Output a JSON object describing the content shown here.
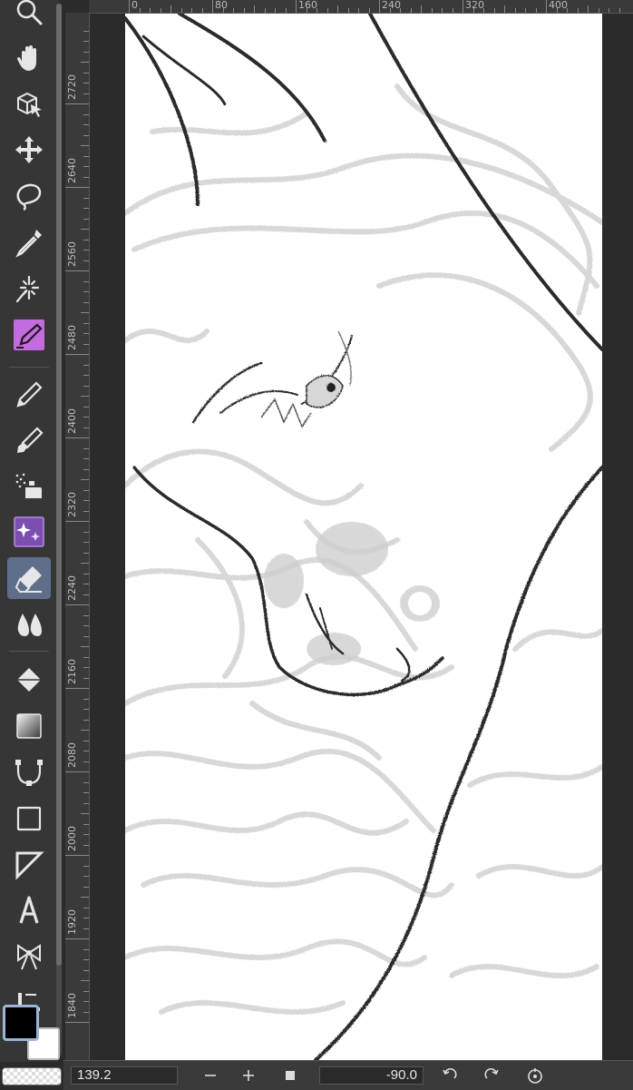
{
  "toolbar": {
    "tools": [
      {
        "name": "zoom-icon",
        "active": false
      },
      {
        "name": "hand-icon",
        "active": false
      },
      {
        "name": "operation-icon",
        "active": false
      },
      {
        "name": "move-layer-icon",
        "active": false
      },
      {
        "name": "lasso-select-icon",
        "active": false
      },
      {
        "name": "eyedropper-icon",
        "active": false
      },
      {
        "name": "auto-select-icon",
        "active": false
      },
      {
        "name": "pen-tool-icon",
        "active": false
      },
      {
        "name": "pencil-icon",
        "active": false
      },
      {
        "name": "brush-icon",
        "active": false
      },
      {
        "name": "airbrush-icon",
        "active": false
      },
      {
        "name": "decoration-icon",
        "active": false
      },
      {
        "name": "eraser-icon",
        "active": true
      },
      {
        "name": "blend-icon",
        "active": false
      },
      {
        "name": "fill-icon",
        "active": false
      },
      {
        "name": "gradient-icon",
        "active": false
      },
      {
        "name": "figure-curve-icon",
        "active": false
      },
      {
        "name": "rectangle-icon",
        "active": false
      },
      {
        "name": "frame-border-icon",
        "active": false
      },
      {
        "name": "text-icon",
        "active": false
      },
      {
        "name": "balloon-icon",
        "active": false
      },
      {
        "name": "ruler-tool-icon",
        "active": false
      }
    ]
  },
  "colors": {
    "main": "#000000",
    "sub": "#ffffff",
    "accent": "#c56be0",
    "active_tool_bg": "#5f6f8a"
  },
  "rulers": {
    "horizontal": [
      "0",
      "80",
      "160",
      "240",
      "320",
      "400"
    ],
    "vertical": [
      "2720",
      "2640",
      "2560",
      "2480",
      "2400",
      "2320",
      "2240",
      "2160",
      "2080",
      "2000",
      "1920",
      "1840"
    ]
  },
  "status": {
    "zoom": "139.2",
    "rotation": "-90.0"
  }
}
